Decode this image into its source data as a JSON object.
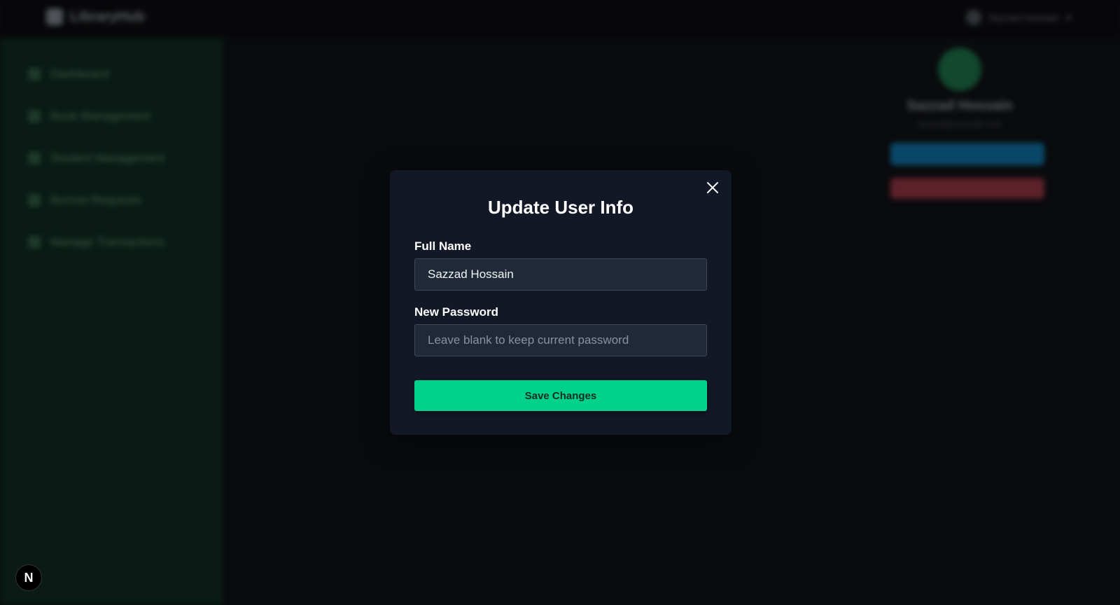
{
  "app": {
    "brand_name": "LibraryHub",
    "user_chip_label": "Sazzad Hossain"
  },
  "sidebar": {
    "items": [
      {
        "label": "Dashboard",
        "icon": "dashboard-icon"
      },
      {
        "label": "Book Management",
        "icon": "book-icon"
      },
      {
        "label": "Student Management",
        "icon": "student-icon"
      },
      {
        "label": "Borrow Requests",
        "icon": "request-icon"
      },
      {
        "label": "Manage Transactions",
        "icon": "transaction-icon"
      }
    ]
  },
  "profile": {
    "name": "Sazzad Hossain",
    "subtitle": "sazzad@example.com",
    "colors": {
      "edit_button": "#0f6ea0",
      "delete_button": "#8e3442",
      "avatar": "#1c6f48"
    }
  },
  "modal": {
    "title": "Update User Info",
    "close_icon": "close-icon",
    "full_name_label": "Full Name",
    "full_name_value": "Sazzad Hossain",
    "password_label": "New Password",
    "password_placeholder": "Leave blank to keep current password",
    "save_label": "Save Changes",
    "colors": {
      "background": "#121826",
      "accent": "#00d18b"
    }
  },
  "dev_badge": {
    "label": "N"
  }
}
